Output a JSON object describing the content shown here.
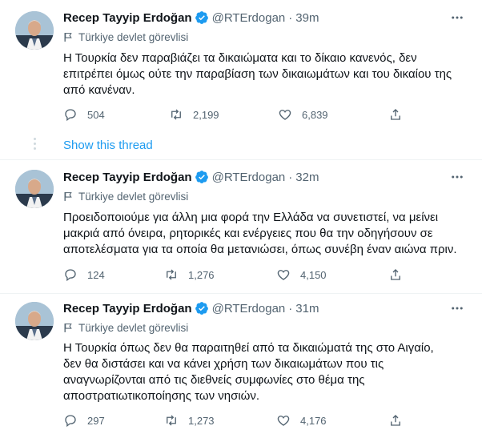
{
  "colors": {
    "accent": "#1d9bf0",
    "secondary_text": "#536471",
    "primary_text": "#0f1419",
    "divider": "#eff3f4",
    "verified": "#1d9bf0"
  },
  "thread": {
    "show_thread_label": "Show this thread"
  },
  "tweets": [
    {
      "name": "Recep Tayyip Erdoğan",
      "handle": "@RTErdogan",
      "separator": "·",
      "time": "39m",
      "label": "Türkiye devlet görevlisi",
      "lines": [
        "Η Τουρκία δεν παραβιάζει  τα δικαιώματα και το δίκαιο κανενός, δεν",
        "επιτρέπει όμως ούτε την παραβίαση των δικαιωμάτων και του δικαίου της",
        "από κανέναν."
      ],
      "replies": "504",
      "retweets": "2,199",
      "likes": "6,839"
    },
    {
      "name": "Recep Tayyip Erdoğan",
      "handle": "@RTErdogan",
      "separator": "·",
      "time": "32m",
      "label": "Türkiye devlet görevlisi",
      "lines": [
        "Προειδοποιούμε για άλλη μια φορά την Ελλάδα να συνετιστεί, να μείνει",
        "μακριά από όνειρα, ρητορικές και ενέργειες που θα την οδηγήσουν σε",
        "αποτελέσματα για τα οποία θα μετανιώσει, όπως συνέβη έναν αιώνα πριν."
      ],
      "replies": "124",
      "retweets": "1,276",
      "likes": "4,150"
    },
    {
      "name": "Recep Tayyip Erdoğan",
      "handle": "@RTErdogan",
      "separator": "·",
      "time": "31m",
      "label": "Türkiye devlet görevlisi",
      "lines": [
        "Η Τουρκία όπως δεν θα παραιτηθεί από τα δικαιώματά της στο Αιγαίο,",
        "δεν θα διστάσει και να κάνει χρήση των δικαιωμάτων  που τις",
        "αναγνωρίζονται από τις διεθνείς συμφωνίες στο θέμα της",
        "αποστρατιωτικοποίησης των νησιών."
      ],
      "replies": "297",
      "retweets": "1,273",
      "likes": "4,176"
    }
  ],
  "icons": {
    "more": "more-icon",
    "verified": "verified-badge-icon",
    "flag": "government-flag-icon",
    "reply": "reply-icon",
    "retweet": "retweet-icon",
    "like": "like-icon",
    "share": "share-icon"
  }
}
